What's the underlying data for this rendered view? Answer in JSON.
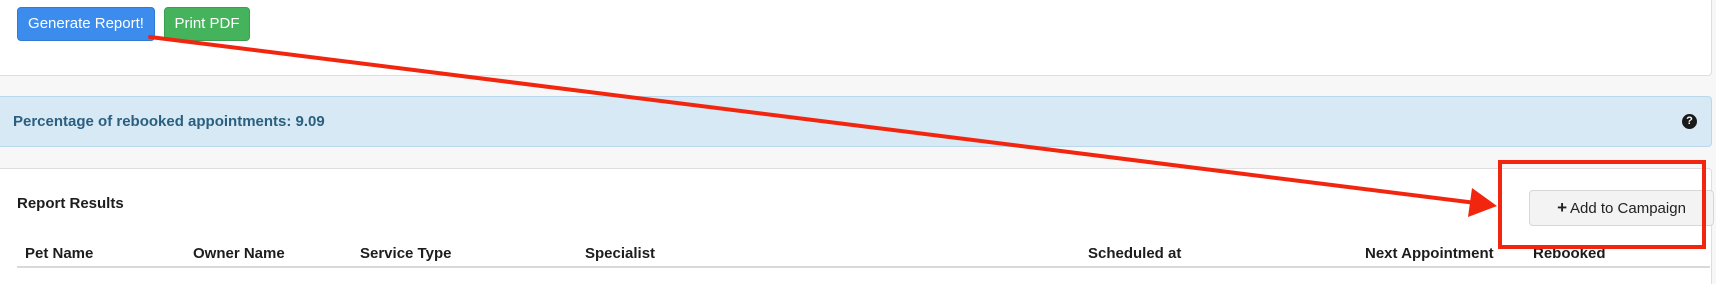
{
  "toolbar": {
    "generate_label": "Generate Report!",
    "print_label": "Print PDF"
  },
  "info": {
    "text": "Percentage of rebooked appointments: 9.09",
    "help_glyph": "?"
  },
  "results": {
    "title": "Report Results",
    "add_campaign_icon": "+",
    "add_campaign_label": "Add to Campaign",
    "columns": [
      "Pet Name",
      "Owner Name",
      "Service Type",
      "Specialist",
      "Scheduled at",
      "Next Appointment",
      "Rebooked"
    ]
  },
  "colors": {
    "primary_blue": "#3b8ced",
    "success_green": "#45b35c",
    "info_bg": "#d6e9f5",
    "info_text": "#2b5f80",
    "annotation_red": "#f2250f"
  },
  "icons": {
    "help": "question-circle-icon",
    "add": "plus-icon"
  }
}
